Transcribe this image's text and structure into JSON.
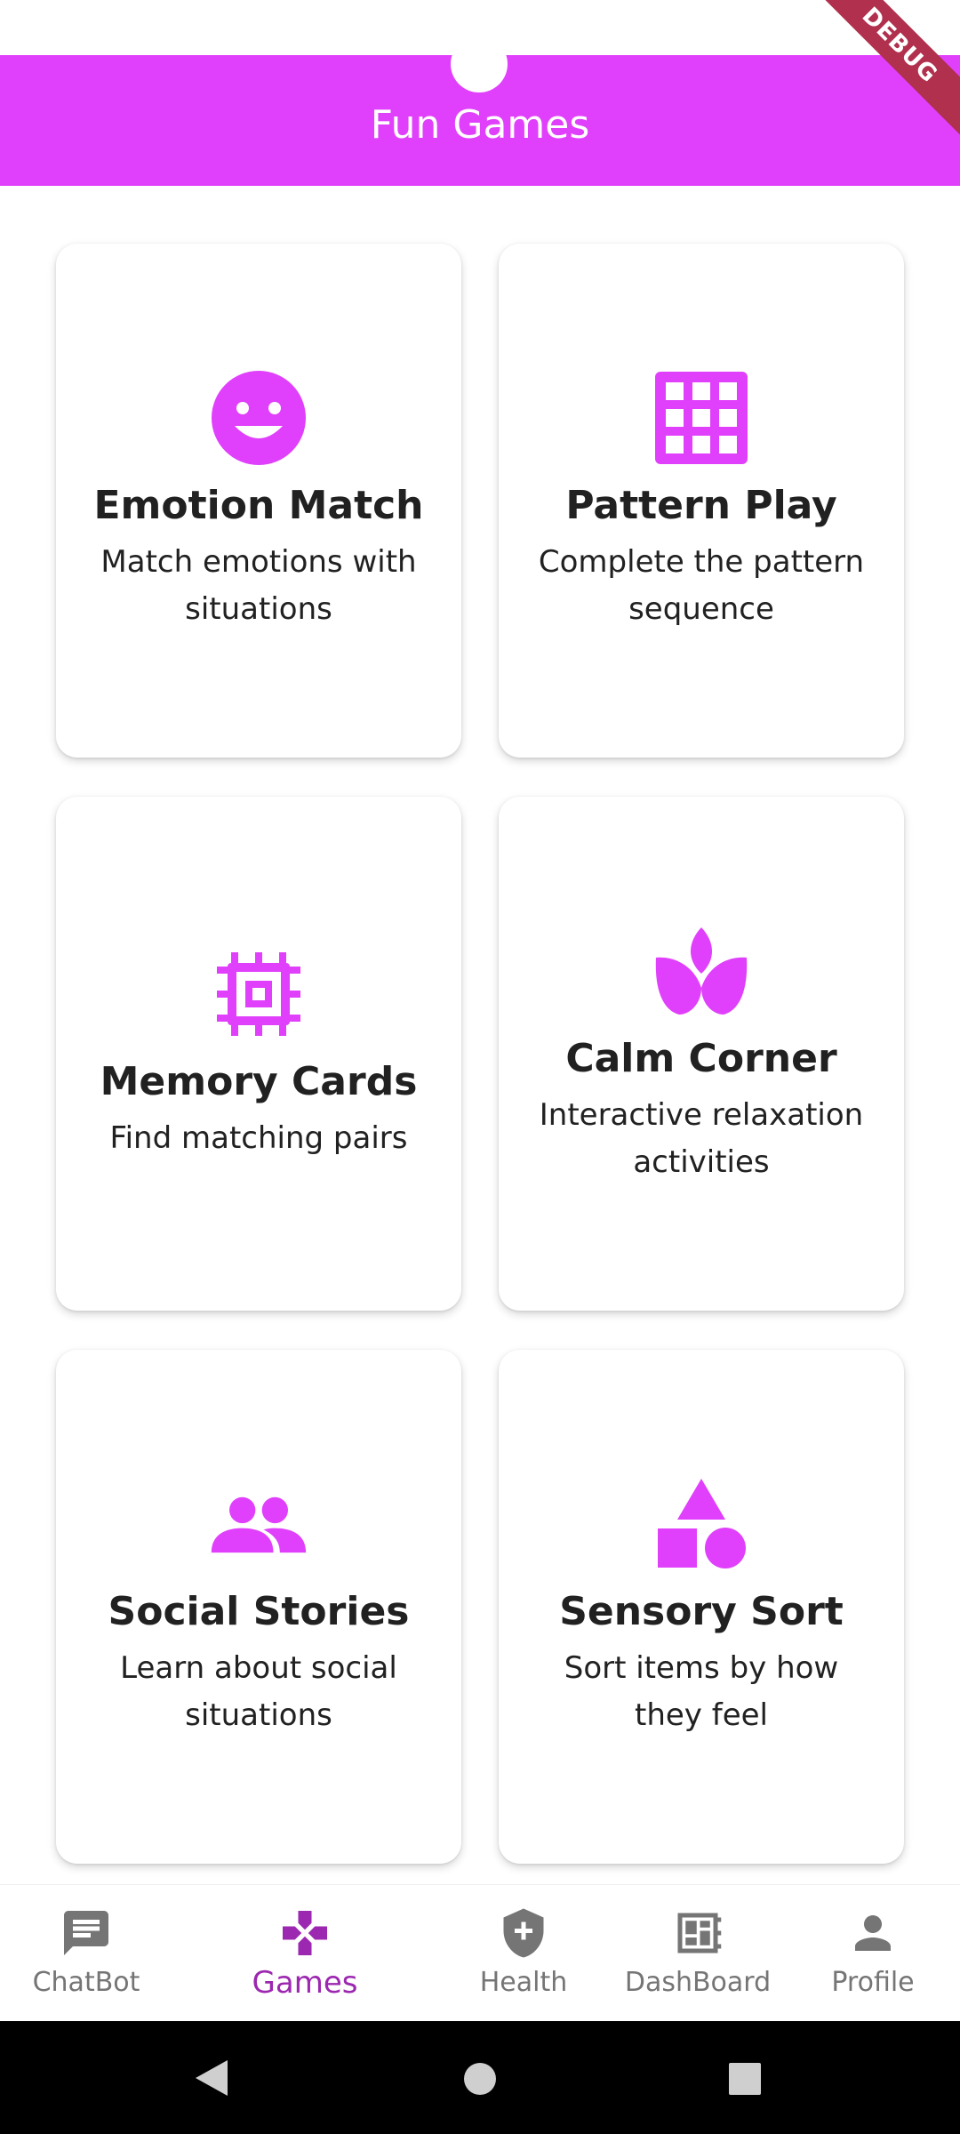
{
  "app": {
    "title": "Fun Games",
    "debug_banner": "DEBUG",
    "accent_color": "#e040fb",
    "active_nav_color": "#9c27b0"
  },
  "games": [
    {
      "title": "Emotion Match",
      "description": "Match emotions with situations",
      "icon": "smiley-face-icon"
    },
    {
      "title": "Pattern Play",
      "description": "Complete the pattern sequence",
      "icon": "grid-icon"
    },
    {
      "title": "Memory Cards",
      "description": "Find matching pairs",
      "icon": "memory-chip-icon"
    },
    {
      "title": "Calm Corner",
      "description": "Interactive relaxation activities",
      "icon": "lotus-icon"
    },
    {
      "title": "Social Stories",
      "description": "Learn about social situations",
      "icon": "people-icon"
    },
    {
      "title": "Sensory Sort",
      "description": "Sort items by how they feel",
      "icon": "shapes-icon"
    }
  ],
  "nav": {
    "items": [
      {
        "label": "ChatBot",
        "icon": "chat-icon"
      },
      {
        "label": "Games",
        "icon": "gamepad-icon",
        "active": true
      },
      {
        "label": "Health",
        "icon": "health-shield-icon"
      },
      {
        "label": "DashBoard",
        "icon": "dashboard-icon"
      },
      {
        "label": "Profile",
        "icon": "person-icon"
      }
    ]
  }
}
